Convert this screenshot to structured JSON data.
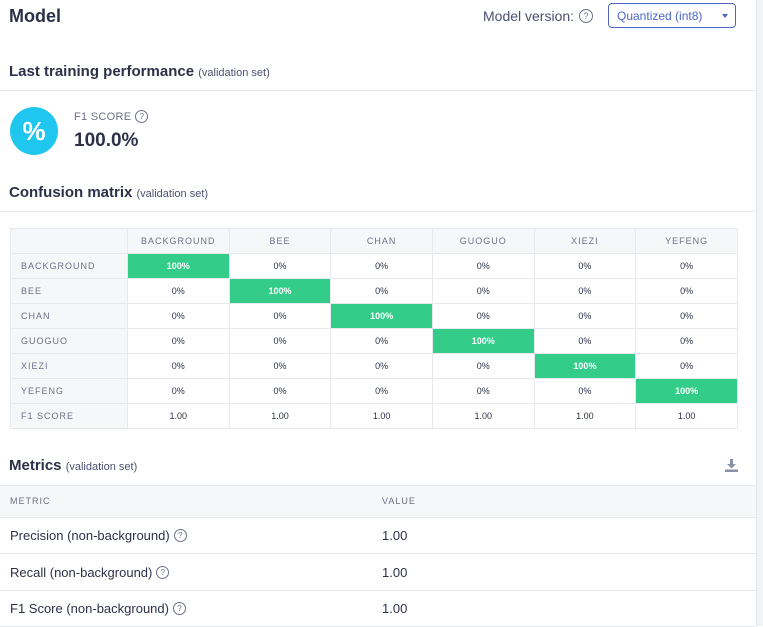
{
  "header": {
    "title": "Model",
    "version_label": "Model version:",
    "version_value": "Quantized (int8)"
  },
  "performance": {
    "title": "Last training performance",
    "subtitle": "(validation set)",
    "icon_symbol": "%",
    "f1_label": "F1 SCORE",
    "f1_value": "100.0%"
  },
  "confusion": {
    "title": "Confusion matrix",
    "subtitle": "(validation set)",
    "columns": [
      "BACKGROUND",
      "BEE",
      "CHAN",
      "GUOGUO",
      "XIEZI",
      "YEFENG"
    ],
    "rows": [
      {
        "label": "BACKGROUND",
        "cells": [
          "100%",
          "0%",
          "0%",
          "0%",
          "0%",
          "0%"
        ]
      },
      {
        "label": "BEE",
        "cells": [
          "0%",
          "100%",
          "0%",
          "0%",
          "0%",
          "0%"
        ]
      },
      {
        "label": "CHAN",
        "cells": [
          "0%",
          "0%",
          "100%",
          "0%",
          "0%",
          "0%"
        ]
      },
      {
        "label": "GUOGUO",
        "cells": [
          "0%",
          "0%",
          "0%",
          "100%",
          "0%",
          "0%"
        ]
      },
      {
        "label": "XIEZI",
        "cells": [
          "0%",
          "0%",
          "0%",
          "0%",
          "100%",
          "0%"
        ]
      },
      {
        "label": "YEFENG",
        "cells": [
          "0%",
          "0%",
          "0%",
          "0%",
          "0%",
          "100%"
        ]
      }
    ],
    "f1_row": {
      "label": "F1 SCORE",
      "cells": [
        "1.00",
        "1.00",
        "1.00",
        "1.00",
        "1.00",
        "1.00"
      ]
    },
    "highlight_color": "#33cc88"
  },
  "metrics": {
    "title": "Metrics",
    "subtitle": "(validation set)",
    "col_metric": "METRIC",
    "col_value": "VALUE",
    "rows": [
      {
        "name": "Precision (non-background)",
        "value": "1.00"
      },
      {
        "name": "Recall (non-background)",
        "value": "1.00"
      },
      {
        "name": "F1 Score (non-background)",
        "value": "1.00"
      }
    ]
  },
  "colors": {
    "accent": "#4d65c9",
    "icon_circle": "#1fc6ee",
    "text": "#2b3148"
  }
}
